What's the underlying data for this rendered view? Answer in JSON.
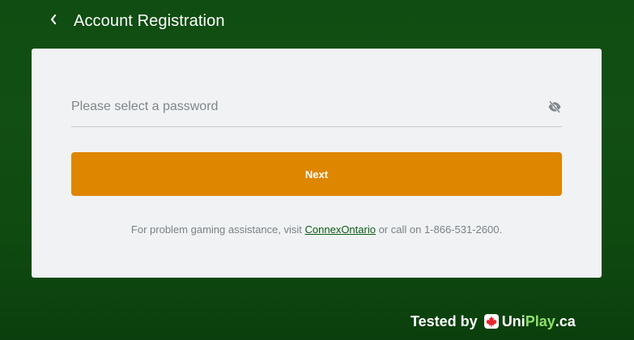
{
  "header": {
    "title": "Account Registration",
    "back_icon": "chevron-left-icon"
  },
  "form": {
    "password_placeholder": "Please select a password",
    "password_value": "",
    "visibility_icon": "eye-off-icon",
    "next_label": "Next"
  },
  "footer": {
    "help_prefix": "For problem gaming assistance, visit ",
    "help_link": "ConnexOntario",
    "help_suffix": " or call on 1-866-531-2600."
  },
  "badge": {
    "tested_by": "Tested by",
    "brand_uni": "Uni",
    "brand_play": "Play",
    "brand_tld": ".ca"
  },
  "colors": {
    "background": "#124f14",
    "card": "#f0f2f3",
    "accent": "#df8600",
    "link": "#0e5a15",
    "brand_green": "#8ee06b",
    "brand_red": "#e3262e"
  }
}
